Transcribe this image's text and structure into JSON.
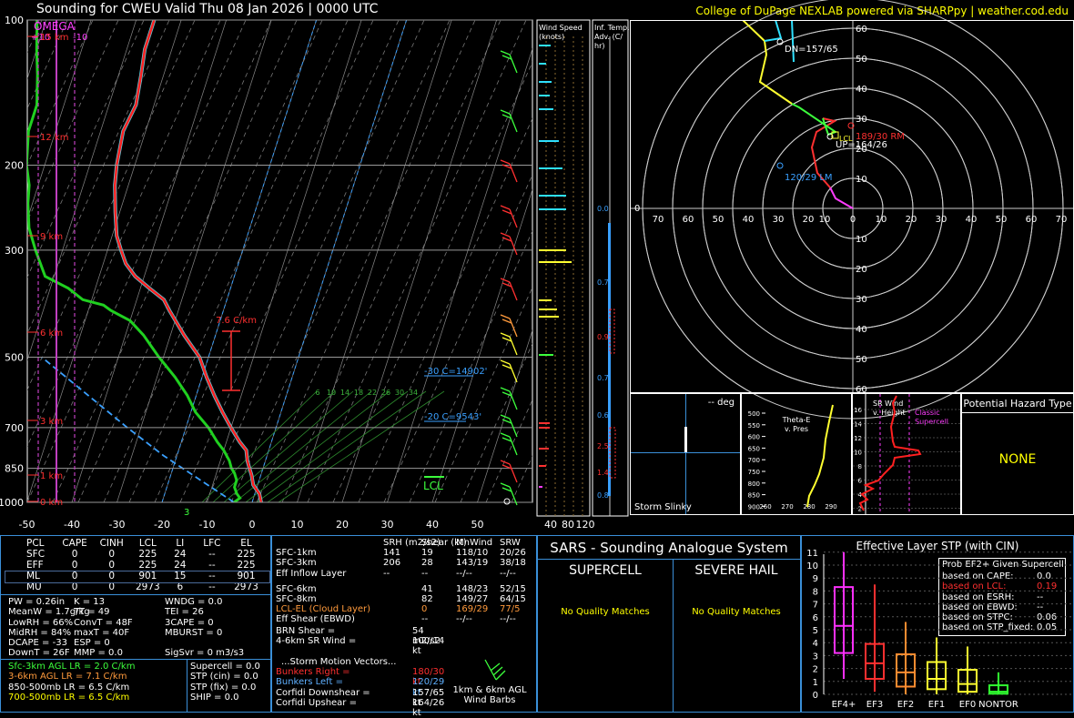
{
  "header": {
    "title": "Sounding for CWEU Valid  Thu 08 Jan 2026 | 0000 UTC",
    "credit": "College of DuPage NEXLAB powered via SHARPpy | weather.cod.edu"
  },
  "skewt": {
    "omega_label": "OMEGA",
    "omega_left": "+10",
    "omega_right": "-10",
    "pressure_ticks": [
      "100",
      "200",
      "300",
      "500",
      "700",
      "850",
      "1000"
    ],
    "pressure_values": [
      100,
      200,
      300,
      500,
      700,
      850,
      1000
    ],
    "temp_ticks": [
      "-50",
      "-40",
      "-30",
      "-20",
      "-10",
      "0",
      "10",
      "20",
      "30",
      "40",
      "50"
    ],
    "temp_values": [
      -50,
      -40,
      -30,
      -20,
      -10,
      0,
      10,
      20,
      30,
      40,
      50
    ],
    "height_labels": [
      "15 km",
      "12 km",
      "9 km",
      "6 km",
      "3 km",
      "1 km",
      "0 km"
    ],
    "lapse_label": "7.6 C/km",
    "lcl_label": "LCL",
    "isotherm_minus30": "-30 C=14902'",
    "isotherm_minus20": "-20 C=9543'",
    "mixing_ratio_labels": [
      "6",
      "10",
      "14",
      "18",
      "22",
      "26",
      "30",
      "34"
    ],
    "sfc_label": "3",
    "temp_profile": [
      [
        1000,
        2
      ],
      [
        960,
        1
      ],
      [
        920,
        -1
      ],
      [
        880,
        -2
      ],
      [
        850,
        -3
      ],
      [
        820,
        -4
      ],
      [
        780,
        -5
      ],
      [
        750,
        -7
      ],
      [
        700,
        -10
      ],
      [
        650,
        -13
      ],
      [
        600,
        -16
      ],
      [
        550,
        -19
      ],
      [
        500,
        -22
      ],
      [
        450,
        -27
      ],
      [
        400,
        -32
      ],
      [
        380,
        -34
      ],
      [
        360,
        -38
      ],
      [
        340,
        -42
      ],
      [
        320,
        -45
      ],
      [
        300,
        -47
      ],
      [
        280,
        -49
      ],
      [
        250,
        -51
      ],
      [
        220,
        -53
      ],
      [
        200,
        -54
      ],
      [
        170,
        -55
      ],
      [
        150,
        -54
      ],
      [
        130,
        -55
      ],
      [
        115,
        -56
      ],
      [
        100,
        -56
      ]
    ],
    "dewpoint_profile": [
      [
        1000,
        -4
      ],
      [
        980,
        -3
      ],
      [
        960,
        -4
      ],
      [
        930,
        -5
      ],
      [
        900,
        -5
      ],
      [
        870,
        -6
      ],
      [
        850,
        -7
      ],
      [
        820,
        -8
      ],
      [
        780,
        -10
      ],
      [
        750,
        -12
      ],
      [
        700,
        -15
      ],
      [
        650,
        -19
      ],
      [
        600,
        -22
      ],
      [
        550,
        -26
      ],
      [
        500,
        -31
      ],
      [
        450,
        -36
      ],
      [
        420,
        -40
      ],
      [
        400,
        -45
      ],
      [
        390,
        -47
      ],
      [
        380,
        -52
      ],
      [
        360,
        -56
      ],
      [
        340,
        -62
      ],
      [
        300,
        -66
      ],
      [
        270,
        -69
      ],
      [
        240,
        -71
      ],
      [
        220,
        -72
      ],
      [
        200,
        -74
      ],
      [
        170,
        -76
      ],
      [
        150,
        -76
      ],
      [
        130,
        -78
      ],
      [
        115,
        -80
      ],
      [
        100,
        -82
      ]
    ],
    "parcel_profile": [
      [
        1000,
        -4
      ],
      [
        900,
        -13
      ],
      [
        800,
        -23
      ],
      [
        700,
        -33
      ],
      [
        600,
        -44
      ],
      [
        500,
        -57
      ]
    ]
  },
  "wind_speed_panel": {
    "title": "Wind Speed (knots)",
    "ticks": [
      "40",
      "80",
      "120"
    ]
  },
  "temp_adv_panel": {
    "title": "Inf. Temp. Adv. (C/hr)",
    "values": [
      "0.0",
      "0.7",
      "0.9",
      "0.7",
      "0.6",
      "2.5",
      "1.4",
      "0.8"
    ]
  },
  "hodograph": {
    "rings": [
      "10",
      "20",
      "30",
      "40",
      "50",
      "60"
    ],
    "x_ticks": [
      "0",
      "70",
      "60",
      "50",
      "40",
      "30",
      "20",
      "10",
      "0",
      "10",
      "20",
      "30",
      "40",
      "50",
      "60",
      "70",
      "0"
    ],
    "dn_label": "DN=157/65",
    "rm_label": "189/30 RM",
    "up_label": "UP=164/26",
    "lm_label": "120/29 LM",
    "lcl_label": "LCL",
    "ring_labels": [
      "60",
      "50",
      "40",
      "30",
      "20",
      "10",
      "10",
      "20",
      "30",
      "40",
      "50",
      "60"
    ]
  },
  "storm_slinky": {
    "title": "Storm Slinky",
    "deg": "-- deg"
  },
  "thetae": {
    "title": "Theta-E v. Pres",
    "y_ticks": [
      "500",
      "550",
      "600",
      "650",
      "700",
      "750",
      "800",
      "850",
      "900",
      "950",
      "1000"
    ],
    "x_ticks": [
      "260",
      "270",
      "280",
      "290"
    ]
  },
  "sr_wind": {
    "title": "SR Wind v. Height",
    "y_ticks": [
      "16",
      "14",
      "12",
      "10",
      "8",
      "6",
      "4",
      "2"
    ],
    "x_ticks": [
      "0",
      "20",
      "40",
      "60",
      "80"
    ],
    "label": "Classic Supercell"
  },
  "hazard": {
    "title": "Potential Hazard Type",
    "value": "NONE"
  },
  "parcels": {
    "headers": [
      "PCL",
      "CAPE",
      "CINH",
      "LCL",
      "LI",
      "LFC",
      "EL"
    ],
    "rows": [
      [
        "SFC",
        "0",
        "0",
        "225",
        "24",
        "--",
        "225"
      ],
      [
        "EFF",
        "0",
        "0",
        "225",
        "24",
        "--",
        "225"
      ],
      [
        "ML",
        "0",
        "0",
        "901",
        "15",
        "--",
        "901"
      ],
      [
        "MU",
        "0",
        "0",
        "2973",
        "6",
        "--",
        "2973"
      ]
    ]
  },
  "indices_col1": [
    "PW = 0.26in",
    "MeanW = 1.7g/kg",
    "LowRH = 66%",
    "MidRH = 84%",
    "DCAPE = -33",
    "DownT = 26F"
  ],
  "indices_col2": [
    "K = 13",
    "TT = 49",
    "ConvT = 48F",
    "maxT = 40F",
    "ESP = 0",
    "MMP = 0.0"
  ],
  "indices_col3": [
    "WNDG = 0.0",
    "TEI = 26",
    "3CAPE = 0",
    "MBURST = 0",
    "",
    "SigSvr = 0 m3/s3"
  ],
  "lapse_rates": [
    {
      "text": "Sfc-3km AGL LR = 2.0 C/km",
      "color": "#3cff3c"
    },
    {
      "text": "3-6km AGL LR = 7.1 C/km",
      "color": "#ff9a3c"
    },
    {
      "text": "850-500mb LR = 6.5 C/km",
      "color": "#ffffff"
    },
    {
      "text": "700-500mb LR = 6.5 C/km",
      "color": "#ffff00"
    }
  ],
  "composite": [
    "Supercell = 0.0",
    "STP (cin) = 0.0",
    "STP (fix) = 0.0",
    "SHIP = 0.0"
  ],
  "kinematics": {
    "headers": [
      "SRH (m2/s2)",
      "Shear (kt)",
      "MnWind",
      "SRW"
    ],
    "rows": [
      {
        "label": "SFC-1km",
        "srh": "141",
        "shear": "19",
        "mnwind": "118/10",
        "srw": "20/26",
        "color": "#ffffff"
      },
      {
        "label": "SFC-3km",
        "srh": "206",
        "shear": "28",
        "mnwind": "143/19",
        "srw": "38/18",
        "color": "#ffffff"
      },
      {
        "label": "Eff Inflow Layer",
        "srh": "--",
        "shear": "--",
        "mnwind": "--/--",
        "srw": "--/--",
        "color": "#ffffff"
      },
      {
        "label": "SFC-6km",
        "srh": "",
        "shear": "41",
        "mnwind": "148/23",
        "srw": "52/15",
        "color": "#ffffff"
      },
      {
        "label": "SFC-8km",
        "srh": "",
        "shear": "82",
        "mnwind": "149/27",
        "srw": "64/15",
        "color": "#ffffff"
      },
      {
        "label": "LCL-EL (Cloud Layer)",
        "srh": "",
        "shear": "0",
        "mnwind": "169/29",
        "srw": "77/5",
        "color": "#ff9a3c"
      },
      {
        "label": "Eff Shear (EBWD)",
        "srh": "",
        "shear": "--",
        "mnwind": "--/--",
        "srw": "--/--",
        "color": "#ffffff"
      }
    ],
    "brn_shear_label": "BRN Shear =",
    "brn_shear": "54 m2/s2",
    "srwind_label": "4-6km SR Wind =",
    "srwind": "100/14 kt",
    "storm_motion_title": "...Storm Motion Vectors...",
    "bunkers_right_label": "Bunkers Right =",
    "bunkers_right": "180/30 kt",
    "bunkers_left_label": "Bunkers Left =",
    "bunkers_left": "120/29 kt",
    "corfidi_down_label": "Corfidi Downshear =",
    "corfidi_down": "157/65 kt",
    "corfidi_up_label": "Corfidi Upshear =",
    "corfidi_up": "164/26 kt",
    "barb_caption": "1km & 6km AGL Wind Barbs"
  },
  "sars": {
    "title": "SARS - Sounding Analogue System",
    "supercell": "SUPERCELL",
    "hail": "SEVERE HAIL",
    "supercell_result": "No Quality Matches",
    "hail_result": "No Quality Matches"
  },
  "stp": {
    "title": "Effective Layer STP (with CIN)",
    "box_title": "Prob EF2+ Given Supercell",
    "probs": [
      {
        "label": "based on CAPE:",
        "value": "0.0",
        "color": "#ffffff"
      },
      {
        "label": "based on LCL:",
        "value": "0.19",
        "color": "#ff3030"
      },
      {
        "label": "based on ESRH:",
        "value": "--",
        "color": "#ffffff"
      },
      {
        "label": "based on EBWD:",
        "value": "--",
        "color": "#ffffff"
      },
      {
        "label": "based on STPC:",
        "value": "0.06",
        "color": "#ffffff"
      },
      {
        "label": "based on STP_fixed:",
        "value": "0.05",
        "color": "#ffffff"
      }
    ],
    "y_ticks": [
      "0",
      "1",
      "2",
      "3",
      "4",
      "5",
      "6",
      "7",
      "8",
      "9",
      "10",
      "11"
    ],
    "categories": [
      "EF4+",
      "EF3",
      "EF2",
      "EF1",
      "EF0",
      "NONTOR"
    ]
  },
  "chart_data": [
    {
      "type": "line",
      "title": "Sounding for CWEU Valid  Thu 08 Jan 2026 | 0000 UTC",
      "xlabel": "",
      "ylabel": "",
      "x_axis": "temperature (C)",
      "y_axis": "pressure (mb, log)",
      "xlim": [
        -50,
        50
      ],
      "ylim": [
        1000,
        100
      ],
      "series": []
    },
    {
      "type": "box",
      "title": "Effective Layer STP (with CIN)",
      "categories": [
        "EF4+",
        "EF3",
        "EF2",
        "EF1",
        "EF0",
        "NONTOR"
      ],
      "whisker_low": [
        1.2,
        0.2,
        0.0,
        0.0,
        0.0,
        0.0
      ],
      "q1": [
        3.2,
        1.2,
        0.6,
        0.4,
        0.2,
        0.05
      ],
      "median": [
        5.3,
        2.4,
        1.7,
        1.2,
        0.8,
        0.2
      ],
      "q3": [
        8.3,
        3.9,
        3.1,
        2.5,
        1.9,
        0.7
      ],
      "whisker_high": [
        11.0,
        8.5,
        5.6,
        4.4,
        3.7,
        1.7
      ],
      "colors": [
        "#ff30ff",
        "#ff3030",
        "#ff8c30",
        "#ffff30",
        "#ffff30",
        "#30ff30"
      ],
      "ylim": [
        0,
        11
      ]
    }
  ]
}
